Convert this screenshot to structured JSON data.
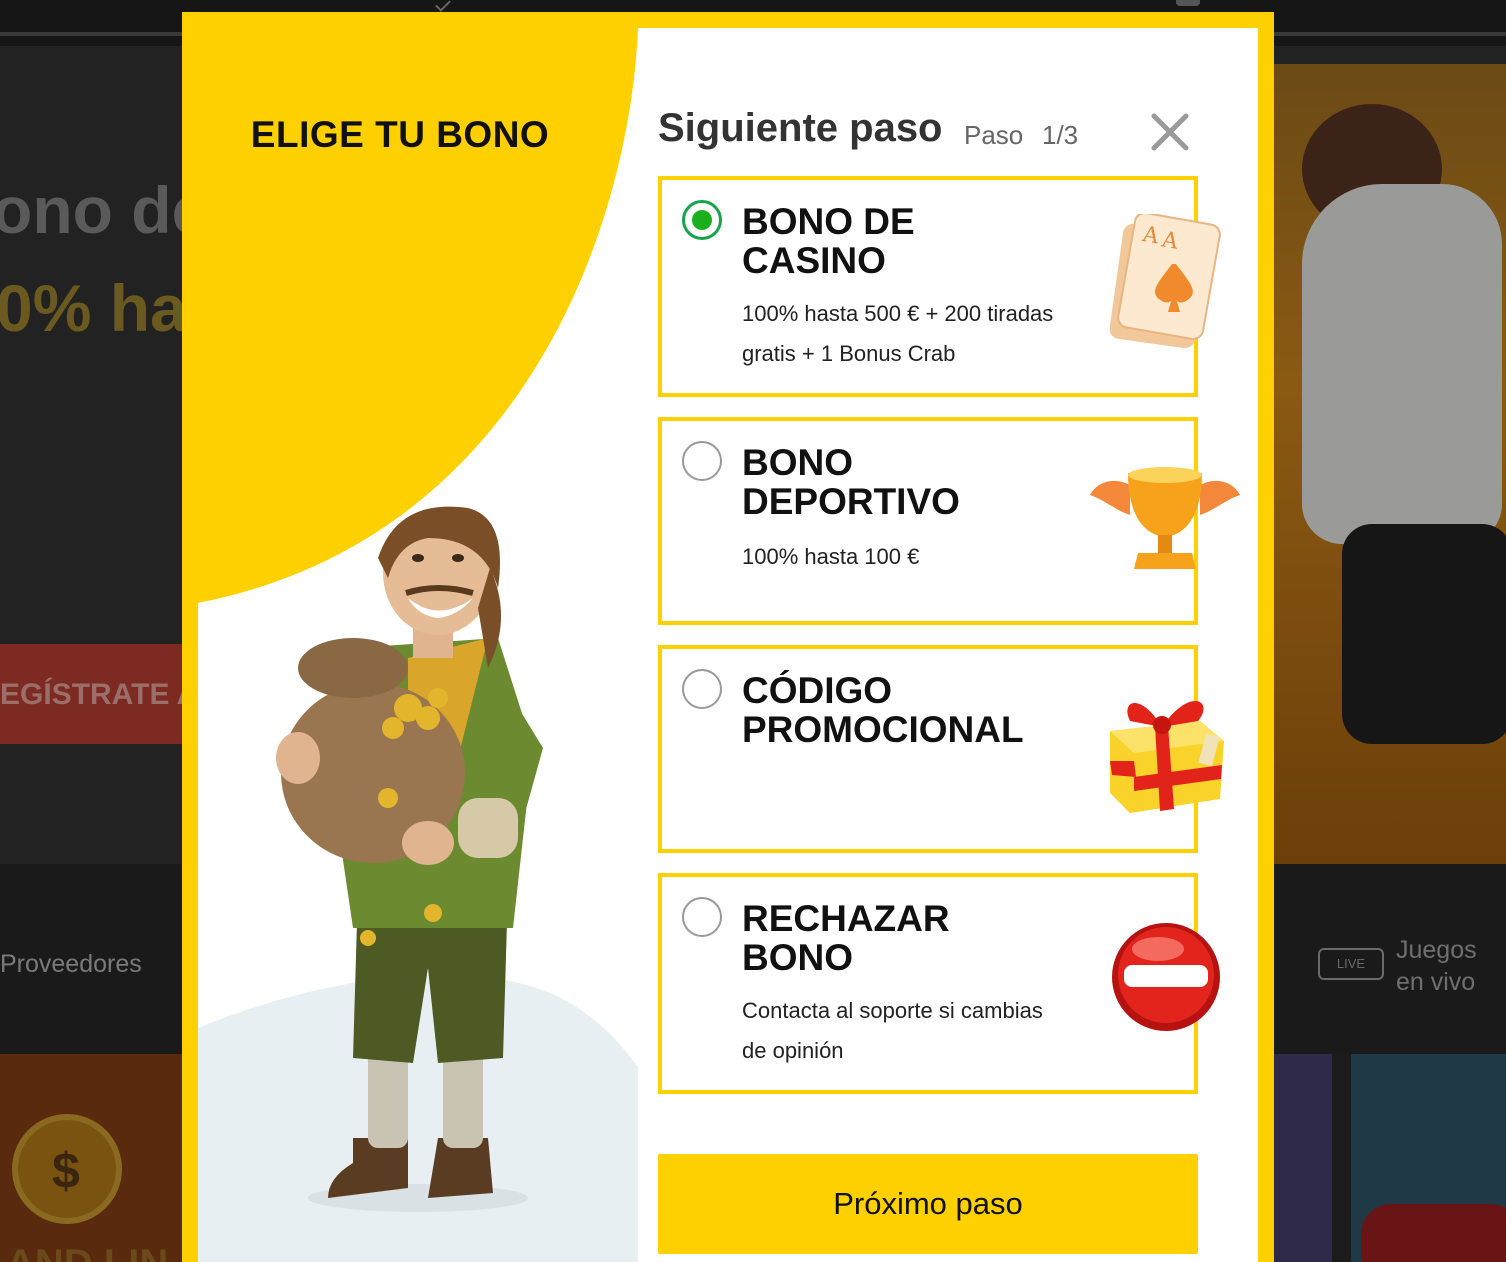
{
  "background": {
    "hero_line1": "ono de",
    "hero_line2": "0% has",
    "cta_label": "EGÍSTRATE A",
    "nav_providers": "Proveedores",
    "live_badge": "LIVE",
    "nav_live_games": "Juegos en vivo",
    "tile_left_text": "AND LIN"
  },
  "modal": {
    "left_title": "ELIGE TU BONO",
    "header": {
      "title": "Siguiente paso",
      "step_label": "Paso",
      "step_count": "1/3"
    },
    "options": [
      {
        "title": "BONO DE CASINO",
        "description": "100% hasta 500 € + 200 tiradas gratis + 1 Bonus Crab",
        "selected": true,
        "icon": "playing-cards-icon"
      },
      {
        "title": "BONO DEPORTIVO",
        "description": "100% hasta 100 €",
        "selected": false,
        "icon": "trophy-icon"
      },
      {
        "title": "CÓDIGO PROMOCIONAL",
        "description": "",
        "selected": false,
        "icon": "gift-box-icon"
      },
      {
        "title": "RECHAZAR BONO",
        "description": "Contacta al soporte si cambias de opinión",
        "selected": false,
        "icon": "no-entry-icon"
      }
    ],
    "next_button": "Próximo paso",
    "accent_color": "#fed000",
    "selected_color": "#1bb01b"
  }
}
